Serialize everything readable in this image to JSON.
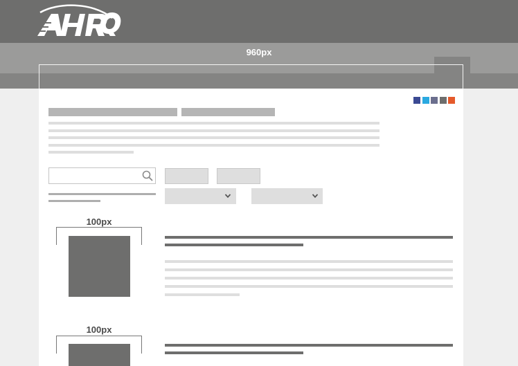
{
  "header": {
    "logo_text": "AHRQ"
  },
  "layout_label": "960px",
  "social_colors": [
    "#3b4a93",
    "#2aa9e0",
    "#6b6f8e",
    "#6e6e6d",
    "#e55a2b"
  ],
  "entries": [
    {
      "image_width_label": "100px"
    },
    {
      "image_width_label": "100px"
    }
  ],
  "icons": {
    "search": "search-icon",
    "dropdown": "chevron-down-icon"
  }
}
